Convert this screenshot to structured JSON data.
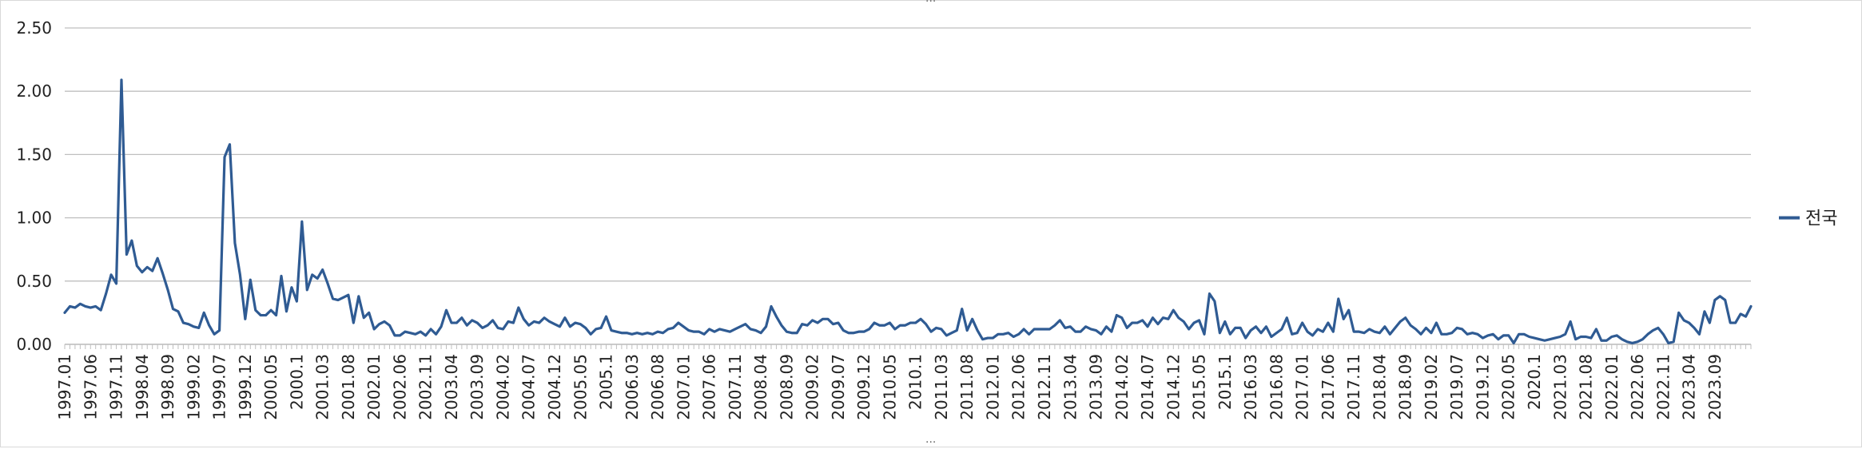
{
  "chart_data": {
    "type": "line",
    "title": "",
    "xlabel": "",
    "ylabel": "",
    "ylim": [
      0,
      2.5
    ],
    "yticks": [
      "0.00",
      "0.50",
      "1.00",
      "1.50",
      "2.00",
      "2.50"
    ],
    "grid": true,
    "legend_position": "right",
    "line_color": "#2f5b93",
    "x_start": "1997.01",
    "x_tick_labels": [
      "1997.01",
      "1997.06",
      "1997.11",
      "1998.04",
      "1998.09",
      "1999.02",
      "1999.07",
      "1999.12",
      "2000.05",
      "2000.1",
      "2001.03",
      "2001.08",
      "2002.01",
      "2002.06",
      "2002.11",
      "2003.04",
      "2003.09",
      "2004.02",
      "2004.07",
      "2004.12",
      "2005.05",
      "2005.1",
      "2006.03",
      "2006.08",
      "2007.01",
      "2007.06",
      "2007.11",
      "2008.04",
      "2008.09",
      "2009.02",
      "2009.07",
      "2009.12",
      "2010.05",
      "2010.1",
      "2011.03",
      "2011.08",
      "2012.01",
      "2012.06",
      "2012.11",
      "2013.04",
      "2013.09",
      "2014.02",
      "2014.07",
      "2014.12",
      "2015.05",
      "2015.1",
      "2016.03",
      "2016.08",
      "2017.01",
      "2017.06",
      "2017.11",
      "2018.04",
      "2018.09",
      "2019.02",
      "2019.07",
      "2019.12",
      "2020.05",
      "2020.1",
      "2021.03",
      "2021.08",
      "2022.01",
      "2022.06",
      "2022.11",
      "2023.04",
      "2023.09"
    ],
    "series": [
      {
        "name": "전국",
        "values": [
          0.25,
          0.3,
          0.29,
          0.32,
          0.3,
          0.29,
          0.3,
          0.27,
          0.4,
          0.55,
          0.48,
          2.09,
          0.71,
          0.82,
          0.62,
          0.57,
          0.61,
          0.58,
          0.68,
          0.56,
          0.43,
          0.28,
          0.26,
          0.17,
          0.16,
          0.14,
          0.13,
          0.25,
          0.15,
          0.08,
          0.11,
          1.48,
          1.58,
          0.8,
          0.55,
          0.2,
          0.51,
          0.27,
          0.23,
          0.23,
          0.27,
          0.23,
          0.54,
          0.26,
          0.45,
          0.34,
          0.97,
          0.43,
          0.55,
          0.52,
          0.59,
          0.48,
          0.36,
          0.35,
          0.37,
          0.39,
          0.17,
          0.38,
          0.21,
          0.25,
          0.12,
          0.16,
          0.18,
          0.15,
          0.07,
          0.07,
          0.1,
          0.09,
          0.08,
          0.1,
          0.07,
          0.12,
          0.08,
          0.14,
          0.27,
          0.17,
          0.17,
          0.21,
          0.15,
          0.19,
          0.17,
          0.13,
          0.15,
          0.19,
          0.13,
          0.12,
          0.18,
          0.17,
          0.29,
          0.2,
          0.15,
          0.18,
          0.17,
          0.21,
          0.18,
          0.16,
          0.14,
          0.21,
          0.14,
          0.17,
          0.16,
          0.13,
          0.08,
          0.12,
          0.13,
          0.22,
          0.11,
          0.1,
          0.09,
          0.09,
          0.08,
          0.09,
          0.08,
          0.09,
          0.08,
          0.1,
          0.09,
          0.12,
          0.13,
          0.17,
          0.14,
          0.11,
          0.1,
          0.1,
          0.08,
          0.12,
          0.1,
          0.12,
          0.11,
          0.1,
          0.12,
          0.14,
          0.16,
          0.12,
          0.11,
          0.09,
          0.14,
          0.3,
          0.22,
          0.15,
          0.1,
          0.09,
          0.09,
          0.16,
          0.15,
          0.19,
          0.17,
          0.2,
          0.2,
          0.16,
          0.17,
          0.11,
          0.09,
          0.09,
          0.1,
          0.1,
          0.12,
          0.17,
          0.15,
          0.15,
          0.17,
          0.12,
          0.15,
          0.15,
          0.17,
          0.17,
          0.2,
          0.16,
          0.1,
          0.13,
          0.12,
          0.07,
          0.09,
          0.11,
          0.28,
          0.11,
          0.2,
          0.11,
          0.04,
          0.05,
          0.05,
          0.08,
          0.08,
          0.09,
          0.06,
          0.08,
          0.12,
          0.08,
          0.12,
          0.12,
          0.12,
          0.12,
          0.15,
          0.19,
          0.13,
          0.14,
          0.1,
          0.1,
          0.14,
          0.12,
          0.11,
          0.08,
          0.14,
          0.1,
          0.23,
          0.21,
          0.13,
          0.17,
          0.17,
          0.19,
          0.14,
          0.21,
          0.16,
          0.21,
          0.2,
          0.27,
          0.21,
          0.18,
          0.12,
          0.17,
          0.19,
          0.08,
          0.4,
          0.34,
          0.09,
          0.18,
          0.08,
          0.13,
          0.13,
          0.05,
          0.11,
          0.14,
          0.09,
          0.14,
          0.06,
          0.09,
          0.12,
          0.21,
          0.08,
          0.09,
          0.17,
          0.1,
          0.07,
          0.12,
          0.1,
          0.17,
          0.1,
          0.36,
          0.2,
          0.27,
          0.1,
          0.1,
          0.09,
          0.12,
          0.1,
          0.09,
          0.14,
          0.08,
          0.13,
          0.18,
          0.21,
          0.15,
          0.12,
          0.08,
          0.13,
          0.09,
          0.17,
          0.08,
          0.08,
          0.09,
          0.13,
          0.12,
          0.08,
          0.09,
          0.08,
          0.05,
          0.07,
          0.08,
          0.04,
          0.07,
          0.07,
          0.01,
          0.08,
          0.08,
          0.06,
          0.05,
          0.04,
          0.03,
          0.04,
          0.05,
          0.06,
          0.08,
          0.18,
          0.04,
          0.06,
          0.06,
          0.05,
          0.12,
          0.03,
          0.03,
          0.06,
          0.07,
          0.04,
          0.02,
          0.01,
          0.02,
          0.04,
          0.08,
          0.11,
          0.13,
          0.08,
          0.01,
          0.02,
          0.25,
          0.19,
          0.17,
          0.13,
          0.08,
          0.26,
          0.17,
          0.35,
          0.38,
          0.35,
          0.17,
          0.17,
          0.24,
          0.22,
          0.3
        ]
      }
    ]
  }
}
